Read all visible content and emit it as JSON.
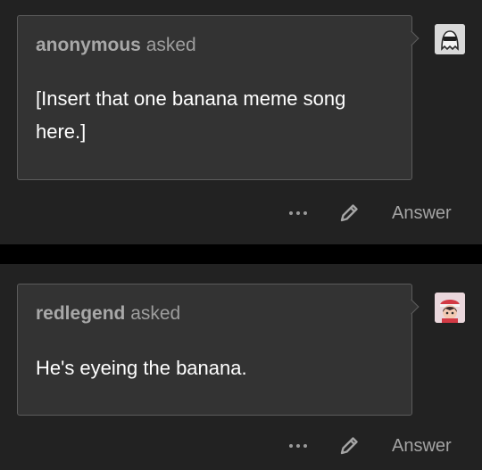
{
  "posts": [
    {
      "asker_name": "anonymous",
      "asked_label": "asked",
      "question": "[Insert that one banana meme song here.]",
      "avatar_icon": "anonymous-ghost-icon",
      "actions": {
        "more_icon": "more-dots-icon",
        "edit_icon": "pencil-icon",
        "answer_label": "Answer"
      }
    },
    {
      "asker_name": "redlegend",
      "asked_label": "asked",
      "question": "He's eyeing the banana.",
      "avatar_icon": "user-avatar",
      "actions": {
        "more_icon": "more-dots-icon",
        "edit_icon": "pencil-icon",
        "answer_label": "Answer"
      }
    }
  ],
  "colors": {
    "background": "#222222",
    "bubble": "#333333",
    "separator": "#000000",
    "text": "#ffffff",
    "muted": "#9e9e9e"
  }
}
